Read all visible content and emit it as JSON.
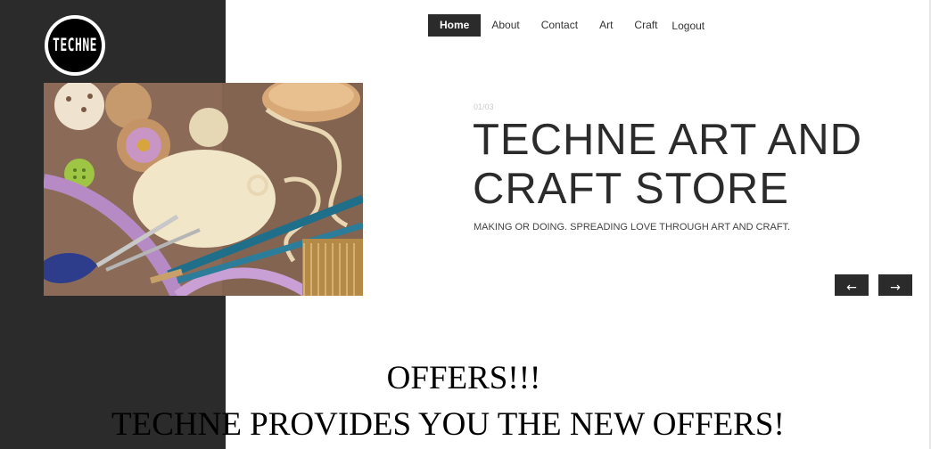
{
  "brand": {
    "logo_text": "TECHNE"
  },
  "nav": {
    "items": [
      {
        "label": "Home",
        "active": true
      },
      {
        "label": "About",
        "active": false
      },
      {
        "label": "Contact",
        "active": false
      },
      {
        "label": "Art",
        "active": false
      },
      {
        "label": "Craft",
        "active": false
      }
    ],
    "logout_label": "Logout"
  },
  "slider": {
    "counter": "01/03",
    "title": "TECHNE ART AND CRAFT STORE",
    "subtitle": "MAKING OR DOING. SPREADING LOVE THROUGH ART AND CRAFT.",
    "prev_symbol": "←",
    "next_symbol": "→"
  },
  "offers": {
    "heading": "OFFERS!!!",
    "text": "TECHNE PROVIDES YOU THE NEW OFFERS!"
  },
  "colors": {
    "dark_panel": "#2b2b2b",
    "background": "#ffffff",
    "title_text": "#2b2b2b"
  },
  "icons": {
    "prev": "arrow-left-icon",
    "next": "arrow-right-icon"
  }
}
